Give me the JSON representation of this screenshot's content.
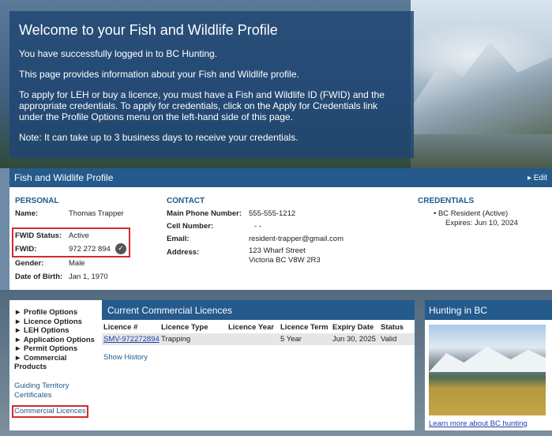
{
  "welcome": {
    "title": "Welcome to your Fish and Wildlife Profile",
    "p1": "You have successfully logged in to BC Hunting.",
    "p2": "This page provides information about your Fish and Wildlife profile.",
    "p3": "To apply for LEH or buy a licence, you must have a Fish and Wildlife ID (FWID) and the appropriate credentials. To apply for credentials, click on the Apply for Credentials link under the Profile Options menu on the left-hand side of this page.",
    "p4": "Note: It can take up to 3 business days to receive your credentials."
  },
  "profile": {
    "title": "Fish and Wildlife Profile",
    "edit": "▸ Edit",
    "personal": {
      "heading": "PERSONAL",
      "name_label": "Name:",
      "name": "Thomas Trapper",
      "fwid_status_label": "FWID Status:",
      "fwid_status": "Active",
      "fwid_label": "FWID:",
      "fwid": "972 272 894",
      "gender_label": "Gender:",
      "gender": "Male",
      "dob_label": "Date of Birth:",
      "dob": "Jan 1, 1970"
    },
    "contact": {
      "heading": "CONTACT",
      "phone_label": "Main Phone Number:",
      "phone": "555-555-1212",
      "cell_label": "Cell Number:",
      "cell": "-  -",
      "email_label": "Email:",
      "email": "resident-trapper@gmail.com",
      "address_label": "Address:",
      "address1": "123 Wharf Street",
      "address2": "Victoria BC V8W 2R3"
    },
    "credentials": {
      "heading": "CREDENTIALS",
      "item": "•  BC Resident (Active)",
      "expires": "Expires: Jun 10, 2024"
    }
  },
  "nav": {
    "items": [
      "► Profile Options",
      "► Licence Options",
      "► LEH Options",
      "► Application Options",
      "► Permit Options",
      "► Commercial Products"
    ],
    "links": [
      "Guiding Territory Certificates",
      "Commercial Licences"
    ]
  },
  "licences": {
    "title": "Current Commercial Licences",
    "headers": [
      "Licence #",
      "Licence Type",
      "Licence Year",
      "Licence Term",
      "Expiry Date",
      "Status"
    ],
    "row": [
      "SMV-972272894",
      "Trapping",
      "",
      "5 Year",
      "Jun 30, 2025",
      "Valid"
    ],
    "history": "Show History"
  },
  "hunting": {
    "title": "Hunting in BC",
    "link": "Learn more about BC hunting"
  },
  "colors": {
    "header_blue": "#245a8c",
    "link_blue": "#1f3fb0",
    "highlight_red": "#d12b2b"
  }
}
